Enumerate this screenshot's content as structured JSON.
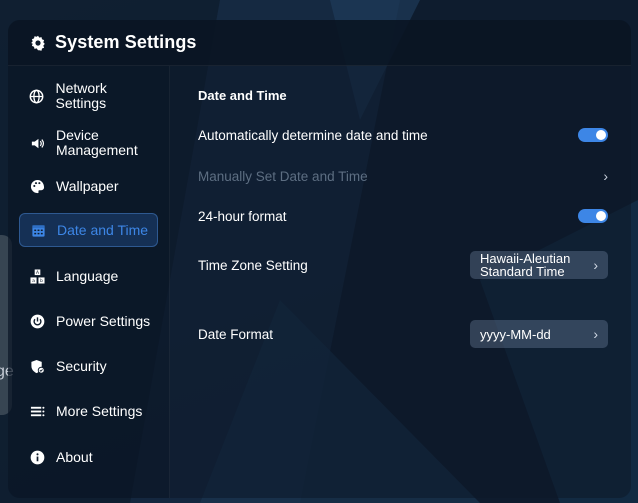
{
  "header": {
    "title": "System Settings",
    "icon": "gear-icon"
  },
  "sidebar": {
    "items": [
      {
        "label": "Network Settings",
        "icon": "globe-icon",
        "active": false
      },
      {
        "label": "Device Management",
        "icon": "speaker-icon",
        "active": false
      },
      {
        "label": "Wallpaper",
        "icon": "palette-icon",
        "active": false
      },
      {
        "label": "Date and Time",
        "icon": "calendar-icon",
        "active": true
      },
      {
        "label": "Language",
        "icon": "language-icon",
        "active": false
      },
      {
        "label": "Power Settings",
        "icon": "power-icon",
        "active": false
      },
      {
        "label": "Security",
        "icon": "shield-icon",
        "active": false
      },
      {
        "label": "More Settings",
        "icon": "more-icon",
        "active": false
      },
      {
        "label": "About",
        "icon": "info-icon",
        "active": false
      }
    ]
  },
  "content": {
    "section_title": "Date and Time",
    "auto_datetime": {
      "label": "Automatically determine date and time",
      "enabled": true
    },
    "manual_datetime": {
      "label": "Manually Set Date and Time",
      "disabled": true
    },
    "hour24": {
      "label": "24-hour format",
      "enabled": true
    },
    "timezone": {
      "label": "Time Zone Setting",
      "value": "Hawaii-Aleutian Standard Time"
    },
    "date_format": {
      "label": "Date Format",
      "value": "yyyy-MM-dd"
    }
  },
  "background": {
    "edge_text": "ge"
  },
  "colors": {
    "accent": "#3d86e6",
    "disabled_text": "#5d6e82",
    "panel": "#0c1828"
  }
}
